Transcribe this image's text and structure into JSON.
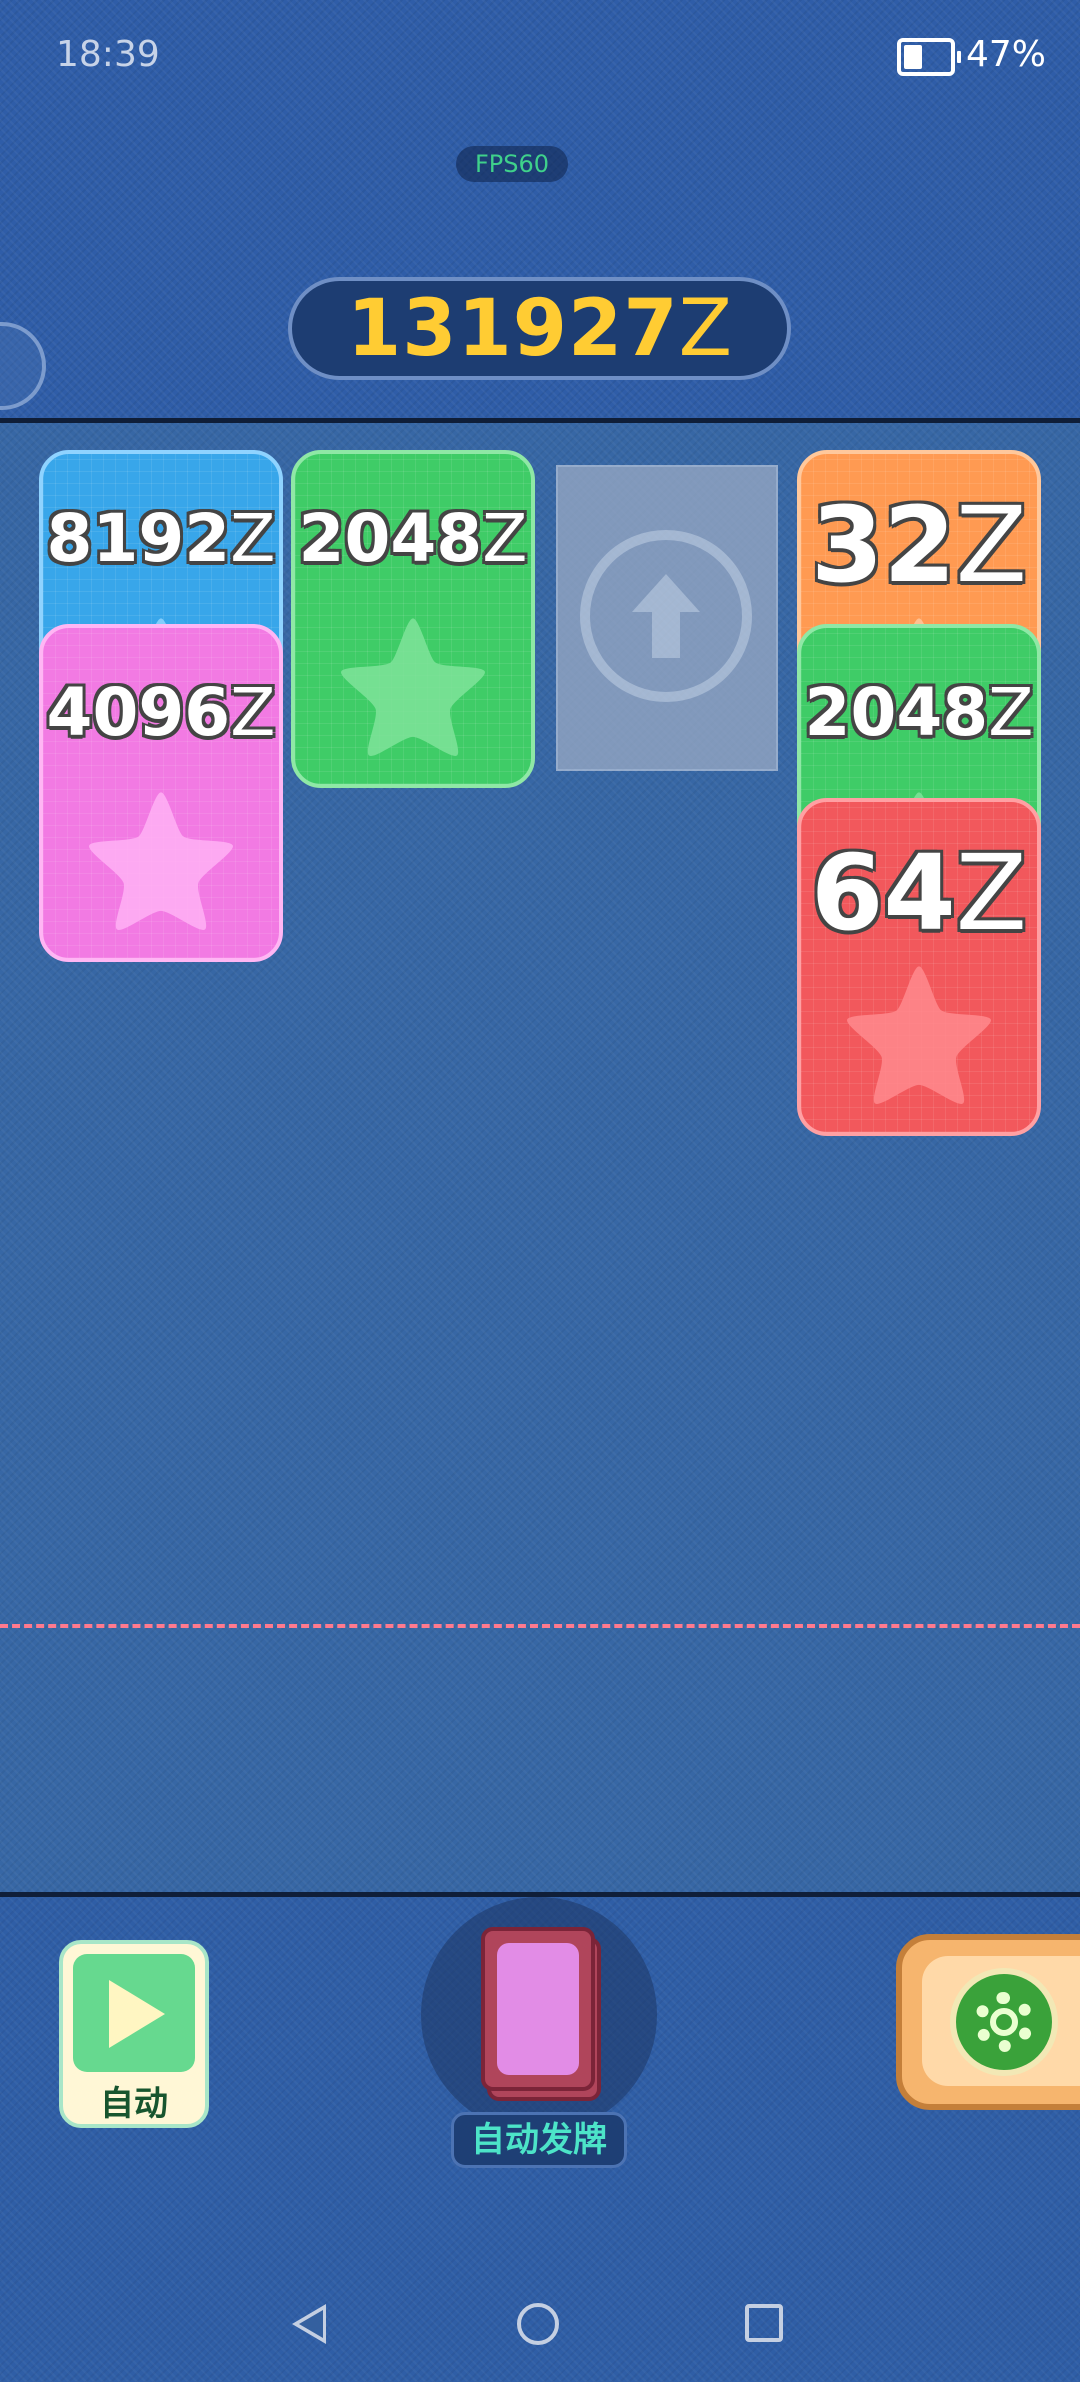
{
  "status_bar": {
    "time": "18:39",
    "battery_percent": "47%",
    "battery_level": 0.47,
    "battery_icon": "battery-icon"
  },
  "fps_label": "FPS60",
  "score": {
    "value": "131927",
    "unit": "Z",
    "color": "#ffcc33"
  },
  "board": {
    "columns": [
      {
        "cards": [
          {
            "value": "8192",
            "unit": "Z",
            "color": "blue"
          },
          {
            "value": "4096",
            "unit": "Z",
            "color": "pink"
          }
        ]
      },
      {
        "cards": [
          {
            "value": "2048",
            "unit": "Z",
            "color": "green"
          }
        ]
      },
      {
        "cards": [],
        "slot_icon": "arrow-up-icon"
      },
      {
        "cards": [
          {
            "value": "32",
            "unit": "Z",
            "color": "orange"
          },
          {
            "value": "2048",
            "unit": "Z",
            "color": "green"
          },
          {
            "value": "64",
            "unit": "Z",
            "color": "red"
          }
        ]
      }
    ],
    "limit_line_color": "#ff7a8e"
  },
  "controls": {
    "auto_label": "自动",
    "auto_icon": "play-icon",
    "deal_label": "自动发牌",
    "deal_icon": "card-deck-icon",
    "settings_icon": "gear-icon"
  },
  "navbar": {
    "back_icon": "back-icon",
    "home_icon": "home-icon",
    "recent_icon": "recent-apps-icon"
  }
}
